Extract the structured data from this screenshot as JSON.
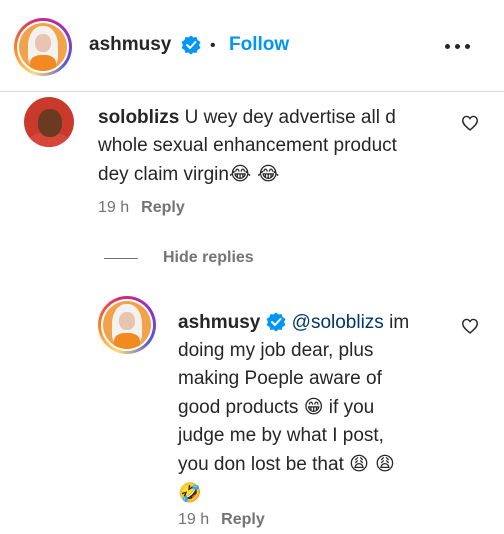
{
  "post": {
    "username": "ashmusy",
    "separator": "•",
    "follow_label": "Follow",
    "verified_icon": "verified-badge-icon",
    "more_icon": "more-options-icon"
  },
  "comment": {
    "username": "soloblizs",
    "text_line1": "U wey dey advertise all d",
    "text_line2": "whole sexual enhancement product",
    "text_line3": "dey claim virgin",
    "emojis": "😂 😂",
    "time": "19 h",
    "reply_label": "Reply"
  },
  "hide_replies_label": "Hide replies",
  "reply": {
    "username": "ashmusy",
    "mention": "@soloblizs",
    "line1": " im",
    "line2": "doing my job dear, plus",
    "line3": "making Poeple aware of",
    "line4": "good products",
    "line4_emoji": "😁",
    "line4_end": "if you",
    "line5": "judge me by what I post,",
    "line6": "you don lost be that",
    "line6_emoji": "😩 😩",
    "line7_emoji": "🤣",
    "time": "19 h",
    "reply_label": "Reply"
  },
  "colors": {
    "follow_blue": "#0095f6",
    "mention_blue": "#00376b",
    "muted_gray": "#737373",
    "text": "#262626"
  }
}
